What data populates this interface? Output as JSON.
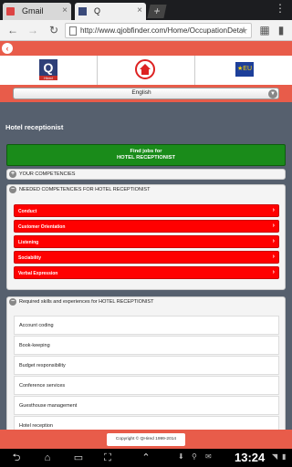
{
  "browser": {
    "tabs": [
      {
        "title": "Gmail"
      },
      {
        "title": "Q"
      }
    ],
    "new_tab_symbol": "+",
    "close_symbol": "×",
    "url": "http://www.qjobfinder.com/Home/OccupationDetail?oc"
  },
  "header": {
    "language_value": "English"
  },
  "occupation": {
    "title": "Hotel receptionist",
    "find_jobs_line1": "Find jobs for",
    "find_jobs_line2": "HOTEL RECEPTIONIST"
  },
  "sections": {
    "your_competencies": "YOUR COMPETENCIES",
    "needed_competencies": "NEEDED COMPETENCIES FOR HOTEL RECEPTIONIST",
    "skills_experiences": "Required skills and experiences for HOTEL RECEPTIONIST"
  },
  "competencies": [
    {
      "label": "Conduct"
    },
    {
      "label": "Customer Orientation"
    },
    {
      "label": "Listening"
    },
    {
      "label": "Sociability"
    },
    {
      "label": "Verbal Expression"
    }
  ],
  "skills": [
    {
      "label": "Account coding"
    },
    {
      "label": "Book-keeping"
    },
    {
      "label": "Budget responsibility"
    },
    {
      "label": "Conference services"
    },
    {
      "label": "Guesthouse management"
    },
    {
      "label": "Hotel reception"
    }
  ],
  "footer": {
    "copyright": "Copyright © QHired 1999-2014"
  },
  "system": {
    "clock": "13:24"
  },
  "colors": {
    "brand_red": "#e85c4a",
    "competency_red": "#ff0000",
    "find_jobs_green": "#1a8b1a",
    "page_background": "#56606e"
  }
}
